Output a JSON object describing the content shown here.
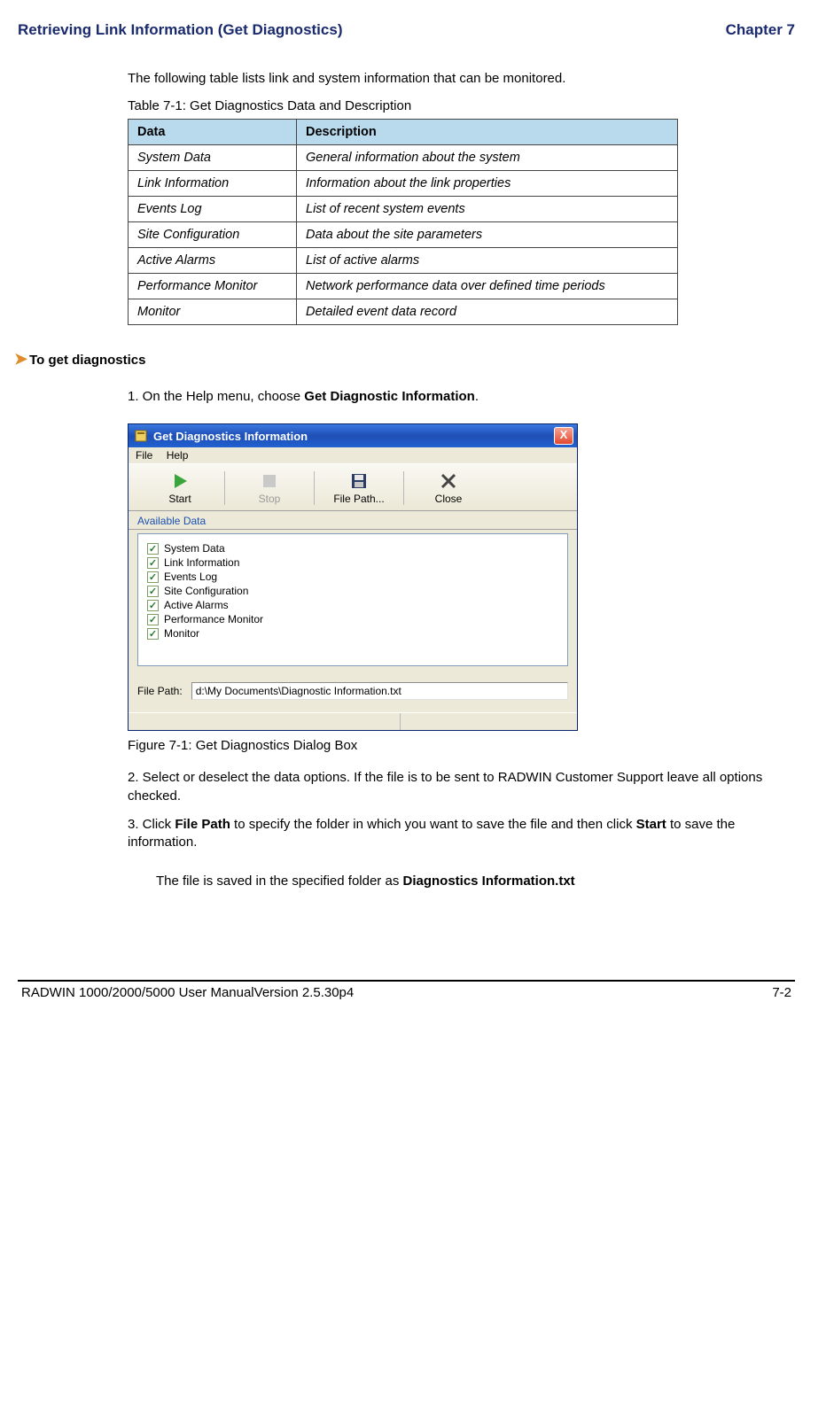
{
  "header": {
    "left": "Retrieving Link Information (Get Diagnostics)",
    "right": "Chapter 7"
  },
  "intro": "The following table lists link and system information that can be monitored.",
  "table": {
    "caption": "Table 7-1: Get Diagnostics Data and Description",
    "headers": {
      "col1": "Data",
      "col2": "Description"
    },
    "rows": [
      {
        "c1": "System Data",
        "c2": "General information about the system"
      },
      {
        "c1": "Link Information",
        "c2": "Information about the link properties"
      },
      {
        "c1": "Events Log",
        "c2": "List of recent system events"
      },
      {
        "c1": "Site Configuration",
        "c2": "Data about the site parameters"
      },
      {
        "c1": "Active Alarms",
        "c2": "List of active alarms"
      },
      {
        "c1": "Performance Monitor",
        "c2": "Network performance data over defined time periods"
      },
      {
        "c1": "Monitor",
        "c2": "Detailed event data record"
      }
    ]
  },
  "procedure": {
    "heading": "To get diagnostics",
    "step1_pre": "1. On the Help menu, choose ",
    "step1_bold": "Get Diagnostic Information",
    "step1_post": "."
  },
  "dialog": {
    "title": "Get Diagnostics Information",
    "close": "X",
    "menu": {
      "file": "File",
      "help": "Help"
    },
    "toolbar": {
      "start": "Start",
      "stop": "Stop",
      "filepath": "File Path...",
      "close": "Close"
    },
    "section": "Available Data",
    "checks": [
      "System Data",
      "Link Information",
      "Events Log",
      "Site Configuration",
      "Active Alarms",
      "Performance Monitor",
      "Monitor"
    ],
    "filepath_label": "File Path:",
    "filepath_value": "d:\\My Documents\\Diagnostic Information.txt"
  },
  "figure_caption": "Figure 7-1: Get Diagnostics Dialog Box",
  "step2": "2. Select or deselect the data options. If the file is to be sent to RADWIN Customer Support leave all options checked.",
  "step3_a": "3. Click ",
  "step3_b": "File Path",
  "step3_c": " to specify the folder in which you want to save the file and then click ",
  "step3_d": "Start",
  "step3_e": " to save the information.",
  "step3_tail_a": "The file is saved in the specified folder as ",
  "step3_tail_b": "Diagnostics Information.txt",
  "footer": {
    "left": "RADWIN 1000/2000/5000 User ManualVersion  2.5.30p4",
    "right": "7-2"
  }
}
